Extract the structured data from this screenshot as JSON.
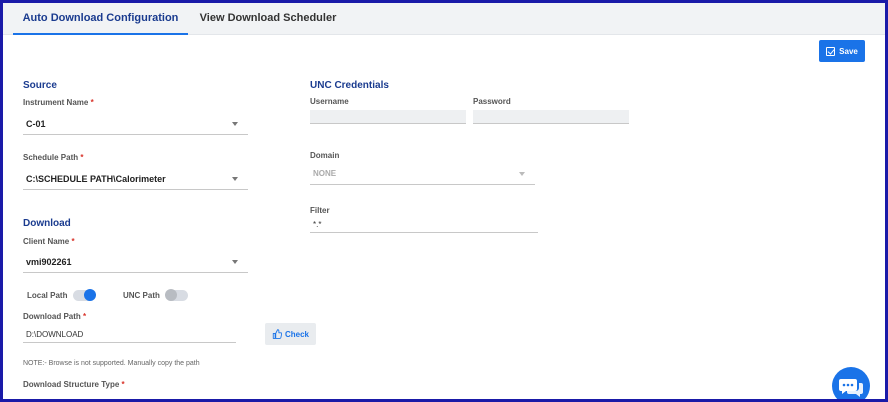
{
  "tabs": [
    {
      "label": "Auto Download Configuration",
      "active": true
    },
    {
      "label": "View Download Scheduler",
      "active": false
    }
  ],
  "toolbar": {
    "save_label": "Save",
    "save_icon": "checkbox-icon"
  },
  "source": {
    "title": "Source",
    "instrument_label": "Instrument Name",
    "instrument_value": "C-01",
    "schedule_label": "Schedule Path",
    "schedule_value": "C:\\SCHEDULE PATH\\Calorimeter"
  },
  "download": {
    "title": "Download",
    "client_label": "Client Name",
    "client_value": "vmi902261",
    "local_path_label": "Local Path",
    "local_path_on": true,
    "unc_path_label": "UNC Path",
    "unc_path_on": false,
    "path_label": "Download Path",
    "path_value": "D:\\DOWNLOAD",
    "check_label": "Check",
    "note": "NOTE:- Browse is not supported. Manually copy the path",
    "structure_label": "Download Structure Type"
  },
  "unc": {
    "title": "UNC Credentials",
    "username_label": "Username",
    "username_value": "",
    "password_label": "Password",
    "password_value": "",
    "domain_label": "Domain",
    "domain_value": "NONE",
    "filter_label": "Filter",
    "filter_value": "*.*"
  },
  "required_mark": "*",
  "colors": {
    "accent": "#1a73e8",
    "title": "#1a3b8f",
    "required": "#d9342b",
    "frame": "#1a1aa8"
  }
}
